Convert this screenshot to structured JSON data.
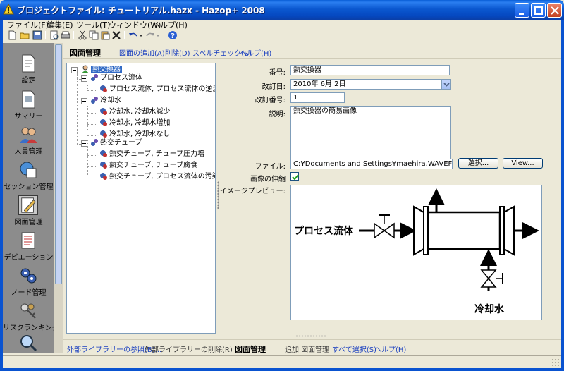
{
  "window": {
    "title": "プロジェクトファイル: チュートリアル.hazx - Hazop+ 2008"
  },
  "menu": [
    "ファイル(F)",
    "編集(E)",
    "ツール(T)",
    "ウィンドウ(W)",
    "ヘルプ(H)"
  ],
  "nav": {
    "items": [
      {
        "label": "設定",
        "icon": "settings-document-icon"
      },
      {
        "label": "サマリー",
        "icon": "summary-document-icon"
      },
      {
        "label": "人員管理",
        "icon": "people-icon"
      },
      {
        "label": "セッション管理",
        "icon": "session-icon"
      },
      {
        "label": "図面管理",
        "icon": "drawing-pencil-icon"
      },
      {
        "label": "デビエーション",
        "icon": "deviation-icon"
      },
      {
        "label": "ノード管理",
        "icon": "node-gears-icon"
      },
      {
        "label": "リスクランキング管理",
        "icon": "risk-keys-icon"
      },
      {
        "label": "",
        "icon": "search-magnifier-icon"
      }
    ],
    "active_index": 4
  },
  "header": {
    "title": "図面管理",
    "links": [
      "図面の追加(A)",
      "削除(D)",
      "スペルチェック(S)",
      "ヘルプ(H)"
    ]
  },
  "tree": {
    "root": "熱交換器",
    "groups": [
      {
        "label": "プロセス流体",
        "children": [
          "プロセス流体, プロセス流体の逆流"
        ]
      },
      {
        "label": "冷却水",
        "children": [
          "冷却水, 冷却水減少",
          "冷却水, 冷却水増加",
          "冷却水, 冷却水なし"
        ]
      },
      {
        "label": "熱交チューブ",
        "children": [
          "熱交チューブ, チューブ圧力増",
          "熱交チューブ, チューブ腐食",
          "熱交チューブ, プロセス流体の汚染"
        ]
      }
    ]
  },
  "form": {
    "number_label": "番号:",
    "number_value": "熱交換器",
    "revdate_label": "改訂日:",
    "revdate_value": "2010年  6月  2日",
    "revnum_label": "改訂番号:",
    "revnum_value": "1",
    "desc_label": "説明:",
    "desc_value": "熱交換器の簡易画像",
    "file_label": "ファイル:",
    "file_value": "C:¥Documents and Settings¥maehira.WAVEFRONT.CO.JP¥",
    "select_button": "選択...",
    "view_button": "View...",
    "stretch_label": "画像の伸縮",
    "stretch_checked": true,
    "preview_label": "イメージプレビュー:"
  },
  "diagram": {
    "process_label": "プロセス流体",
    "cooling_label": "冷却水"
  },
  "bottom": {
    "left_link": "外部ライブラリーの参照(B)...",
    "left_text": "外部ライブラリーの削除(R)",
    "title": "図面管理",
    "add_text": "追加 図面管理",
    "links": [
      "すべて選択(S)",
      "ヘルプ(H)"
    ]
  }
}
